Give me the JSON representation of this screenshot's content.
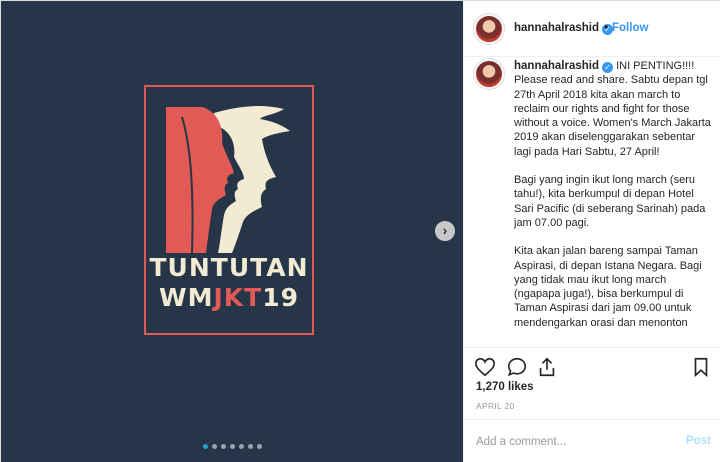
{
  "colors": {
    "media_bg": "#263547",
    "poster_red": "#e25a55",
    "poster_cream": "#f2ead2",
    "link_blue": "#3897f0"
  },
  "poster": {
    "line1": "TUNTUTAN",
    "line2_white": "WM",
    "line2_red": "JKT",
    "line2_white_end": "19"
  },
  "carousel": {
    "next_icon": "chevron-right-icon",
    "next_glyph": "›",
    "slide_count": 7,
    "active_index": 0
  },
  "header": {
    "username": "hannahalrashid",
    "separator": "•",
    "follow_label": "Follow",
    "verified_glyph": "✓"
  },
  "caption": {
    "username": "hannahalrashid",
    "paragraphs": [
      "INI PENTING!!!! Please read and share. Sabtu depan tgl 27th April 2018 kita akan march to reclaim our rights and fight for those without a voice. Women's March Jakarta 2019 akan diselenggarakan sebentar lagi pada Hari Sabtu, 27 April!",
      "Bagi yang ingin ikut long march (seru tahu!), kita berkumpul di depan Hotel Sari Pacific (di seberang Sarinah) pada jam 07.00 pagi.",
      "Kita akan jalan bareng sampai Taman Aspirasi, di depan Istana Negara. Bagi yang tidak mau ikut long march (ngapapa juga!), bisa berkumpul di Taman Aspirasi dari jam 09.00 untuk mendengarkan orasi dan menonton"
    ]
  },
  "actions": {
    "like_icon": "heart-icon",
    "comment_icon": "comment-bubble-icon",
    "share_icon": "share-icon",
    "save_icon": "bookmark-icon"
  },
  "likes_text": "1,270 likes",
  "date_text": "APRIL 20",
  "comment_box": {
    "placeholder": "Add a comment...",
    "post_label": "Post"
  }
}
